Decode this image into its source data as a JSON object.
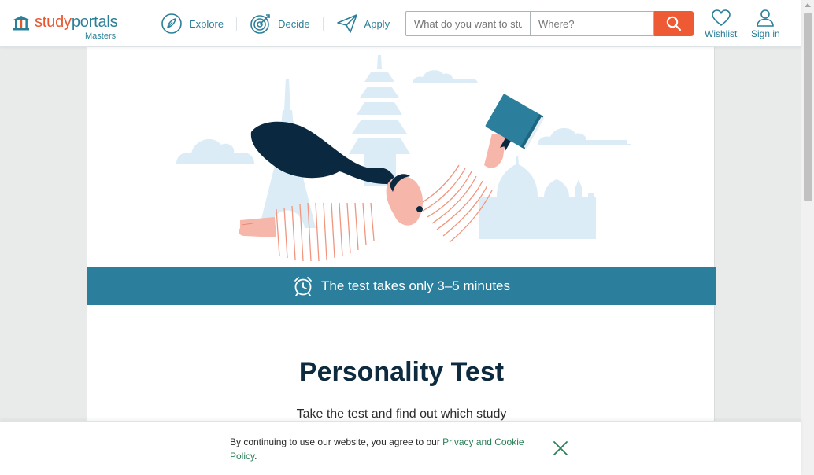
{
  "header": {
    "logo_study": "study",
    "logo_portals": "portals",
    "logo_sub": "Masters",
    "nav": [
      {
        "label": "Explore",
        "icon": "compass-leaf-icon"
      },
      {
        "label": "Decide",
        "icon": "target-icon"
      },
      {
        "label": "Apply",
        "icon": "paper-plane-icon"
      }
    ],
    "search": {
      "what_placeholder": "What do you want to study?",
      "where_placeholder": "Where?",
      "button_icon": "search-icon"
    },
    "wishlist_label": "Wishlist",
    "signin_label": "Sign in"
  },
  "banner": {
    "text": "The test takes only 3–5 minutes",
    "icon": "alarm-clock-icon"
  },
  "main": {
    "title": "Personality Test",
    "subtitle": "Take the test and find out which study"
  },
  "cookie": {
    "text": "By continuing to use our website, you agree to our ",
    "link": "Privacy and Cookie Policy",
    "end": "."
  },
  "colors": {
    "brand_orange": "#ee5a33",
    "brand_teal": "#2a7f99",
    "banner_blue": "#2b7f9c",
    "title_navy": "#0d2a3e"
  }
}
